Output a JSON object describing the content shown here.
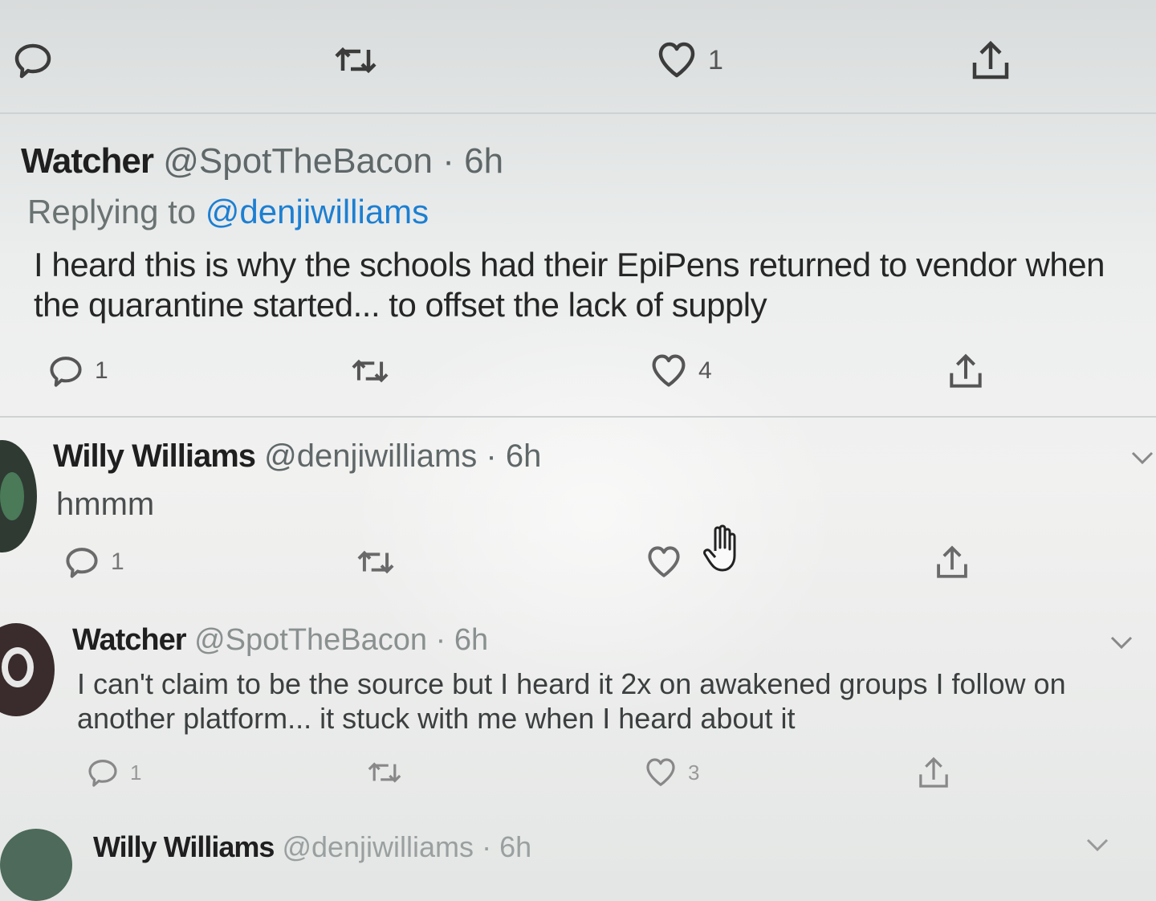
{
  "top_actions": {
    "like_count": "1"
  },
  "tweets": [
    {
      "name": "Watcher",
      "handle": "@SpotTheBacon",
      "time": "6h",
      "reply_prefix": "Replying to",
      "reply_to": "@denjiwilliams",
      "text": "I heard this is why the schools had their EpiPens returned to vendor when the quarantine started... to offset the lack of supply",
      "reply_count": "1",
      "like_count": "4"
    },
    {
      "name": "Willy Williams",
      "handle": "@denjiwilliams",
      "time": "6h",
      "text": "hmmm",
      "reply_count": "1"
    },
    {
      "name": "Watcher",
      "handle": "@SpotTheBacon",
      "time": "6h",
      "text": "I can't claim to be the source but I heard it 2x on awakened groups I follow on another platform... it stuck with me when I heard about it",
      "reply_count": "1",
      "like_count": "3"
    },
    {
      "name": "Willy Williams",
      "handle": "@denjiwilliams",
      "time": "6h"
    }
  ],
  "separator": "·",
  "icons": {
    "reply": "reply-icon",
    "retweet": "retweet-icon",
    "like": "heart-icon",
    "share": "share-icon",
    "caret": "chevron-down-icon",
    "cursor": "hand-pointer-icon"
  }
}
